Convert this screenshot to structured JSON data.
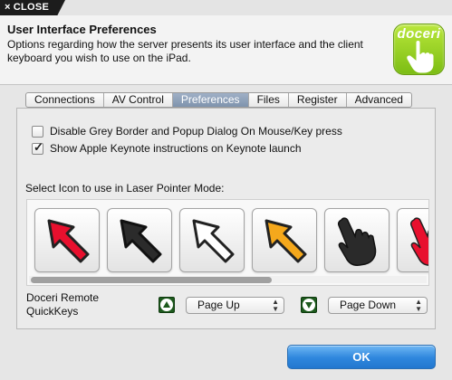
{
  "topbar": {
    "close_label": "CLOSE",
    "close_icon": "×"
  },
  "header": {
    "title": "User Interface Preferences",
    "description": "Options regarding how the server presents its user interface and the client keyboard you wish to use on the iPad.",
    "logo_text": "doceri"
  },
  "tabs": [
    {
      "label": "Connections",
      "active": false
    },
    {
      "label": "AV Control",
      "active": false
    },
    {
      "label": "Preferences",
      "active": true
    },
    {
      "label": "Files",
      "active": false
    },
    {
      "label": "Register",
      "active": false
    },
    {
      "label": "Advanced",
      "active": false
    }
  ],
  "options": {
    "disable_grey_border": {
      "label": "Disable Grey Border and Popup Dialog On Mouse/Key press",
      "checked": false
    },
    "show_keynote": {
      "label": "Show Apple Keynote instructions on Keynote launch",
      "checked": true
    }
  },
  "laser": {
    "label": "Select Icon to use in Laser Pointer Mode:",
    "icons": [
      "red-arrow-icon",
      "black-arrow-icon",
      "white-arrow-icon",
      "orange-arrow-icon",
      "black-hand-icon",
      "red-hand-icon"
    ]
  },
  "quickkeys": {
    "label": "Doceri Remote QuickKeys",
    "up_value": "Page Up",
    "down_value": "Page Down"
  },
  "ok_label": "OK",
  "colors": {
    "accent": "#2e86dd",
    "logo_green": "#8cc81a",
    "quickkey_green": "#1d5a1d"
  }
}
